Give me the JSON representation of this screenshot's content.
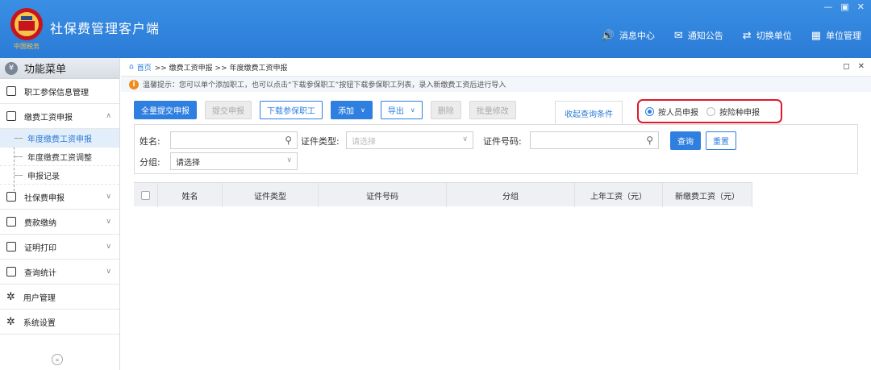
{
  "app": {
    "title": "社保费管理客户端",
    "logo_text": "中国税务",
    "win_ctrls": [
      "—",
      "▣",
      "✕"
    ]
  },
  "header_menu": [
    {
      "label": "消息中心",
      "icon": "speaker-icon",
      "glyph": "🔊"
    },
    {
      "label": "通知公告",
      "icon": "mail-icon",
      "glyph": "✉"
    },
    {
      "label": "切换单位",
      "icon": "switch-icon",
      "glyph": "⇄"
    },
    {
      "label": "单位管理",
      "icon": "building-icon",
      "glyph": "▦"
    }
  ],
  "sidebar": {
    "title": "功能菜单",
    "items": [
      {
        "label": "职工参保信息管理"
      },
      {
        "label": "缴费工资申报",
        "expanded": true
      },
      {
        "label": "年度缴费工资申报",
        "sub": true,
        "active": true
      },
      {
        "label": "年度缴费工资调整",
        "sub": true
      },
      {
        "label": "申报记录",
        "sub": true
      },
      {
        "label": "社保费申报"
      },
      {
        "label": "费款缴纳"
      },
      {
        "label": "证明打印"
      },
      {
        "label": "查询统计"
      },
      {
        "label": "用户管理"
      },
      {
        "label": "系统设置"
      }
    ],
    "collapse_glyph": "«"
  },
  "breadcrumb": {
    "home": "首页",
    "path": ">> 缴费工资申报 >> 年度缴费工资申报",
    "ctrls": [
      "◻",
      "✕"
    ]
  },
  "tip": {
    "icon_glyph": "i",
    "text": "温馨提示：您可以单个添加职工，也可以点击“下载参保职工”按钮下载参保职工列表，录入新缴费工资后进行导入"
  },
  "toolbar": {
    "submit_all": "全量提交申报",
    "submit": "提交申报",
    "download": "下载参保职工",
    "add": "添加",
    "export": "导出",
    "delete": "删除",
    "batch_edit": "批量修改",
    "collapse": "收起查询条件",
    "dd_glyph": "∨"
  },
  "radios": {
    "by_person": "按人员申报",
    "by_insurance": "按险种申报",
    "selected": "by_person"
  },
  "search": {
    "name_label": "姓名:",
    "name_value": "",
    "id_type_label": "证件类型:",
    "id_type_placeholder": "请选择",
    "id_no_label": "证件号码:",
    "id_no_value": "",
    "group_label": "分组:",
    "group_value": "请选择",
    "query": "查询",
    "reset": "重置",
    "search_glyph": "🔍"
  },
  "table": {
    "columns": [
      "姓名",
      "证件类型",
      "证件号码",
      "分组",
      "上年工资（元）",
      "新缴费工资（元）"
    ],
    "rows": []
  }
}
